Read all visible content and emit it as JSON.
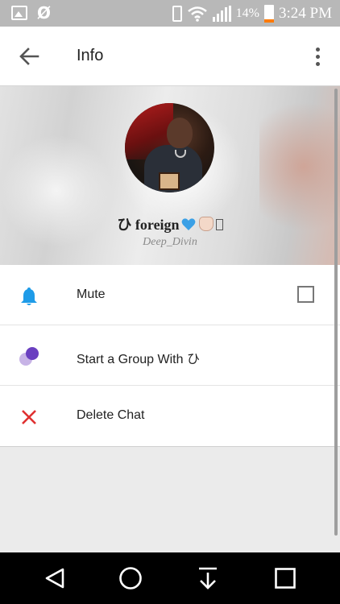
{
  "status_bar": {
    "left_icons": [
      "image-icon",
      "null-icon"
    ],
    "null_glyph": "Ø",
    "battery_percent": "14%",
    "time": "3:24 PM",
    "battery_level": 0.14,
    "colors": {
      "background": "#b8b8b8",
      "battery_low": "#ff7a00"
    }
  },
  "toolbar": {
    "title": "Info",
    "back_icon": "arrow-back-icon",
    "menu_icon": "more-vert-icon"
  },
  "profile": {
    "name_prefix": "ひ foreign",
    "emojis": [
      "blue-heart-icon",
      "raised-hand-icon",
      "unknown-glyph-icon"
    ],
    "username": "Deep_Divin"
  },
  "options": [
    {
      "id": "mute",
      "label": "Mute",
      "icon": "bell-icon",
      "icon_color": "#1e9be8",
      "checked": false
    },
    {
      "id": "group",
      "label": "Start a Group With ひ",
      "icon": "group-dots-icon",
      "icon_color": "#7a4fc8"
    },
    {
      "id": "delete",
      "label": "Delete Chat",
      "icon": "close-icon",
      "icon_color": "#e03030"
    }
  ],
  "nav_bar": {
    "buttons": [
      "back-triangle-icon",
      "home-circle-icon",
      "download-icon",
      "recents-square-icon"
    ]
  }
}
